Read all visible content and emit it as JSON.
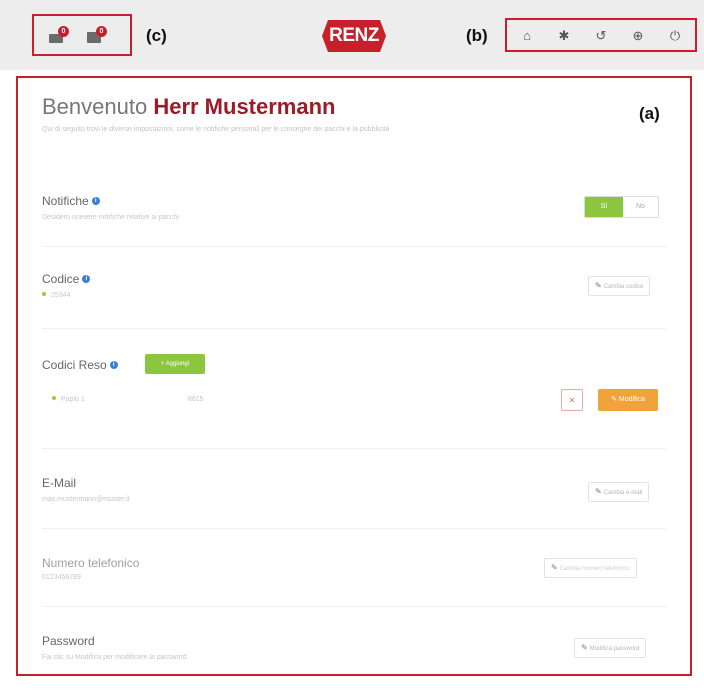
{
  "annotations": {
    "a": "(a)",
    "b": "(b)",
    "c": "(c)"
  },
  "header": {
    "logo_text": "RENZ",
    "tray_icons": [
      {
        "icon": "parcel-tray-icon",
        "badge": "0"
      },
      {
        "icon": "parcel-box-icon",
        "badge": "0"
      }
    ],
    "nav_icons": [
      {
        "icon": "home-icon",
        "glyph": "⌂"
      },
      {
        "icon": "gear-icon",
        "glyph": "✱"
      },
      {
        "icon": "history-icon",
        "glyph": "↺"
      },
      {
        "icon": "globe-icon",
        "glyph": "⊕"
      },
      {
        "icon": "power-icon",
        "glyph": "⏻"
      }
    ]
  },
  "main": {
    "welcome_prefix": "Benvenuto",
    "welcome_name": "Herr Mustermann",
    "subtitle": "Qui di seguito trovi le diverse impostazioni, come le notifiche personali per le consegne dei pacchi e la pubblicità",
    "notifications": {
      "title": "Notifiche",
      "subtitle": "Desidero ricevere notifiche relative ai pacchi",
      "toggle_on": "Sì",
      "toggle_off": "No"
    },
    "code": {
      "title": "Codice",
      "value": "25344",
      "button": "Cambia codice"
    },
    "return_codes": {
      "title": "Codici Reso",
      "add_button": "+ Aggiungi",
      "item_label": "Paplo 1",
      "item_value": "8815",
      "delete_button": "×",
      "edit_button": "Modifica"
    },
    "email": {
      "title": "E-Mail",
      "value": "max.mustermann@muster.it",
      "button": "Cambia e-mail"
    },
    "phone": {
      "title": "Numero telefonico",
      "value": "0123456789",
      "button": "Cambia numero telefonico"
    },
    "password": {
      "title": "Password",
      "subtitle": "Fai clic su Modifica per modificare la password",
      "button": "Modifica password"
    }
  },
  "colors": {
    "accent_red": "#c8202b",
    "name_red": "#9b1c27",
    "green": "#8cc63f",
    "orange": "#f0a33a",
    "info_blue": "#3a7fd1"
  }
}
